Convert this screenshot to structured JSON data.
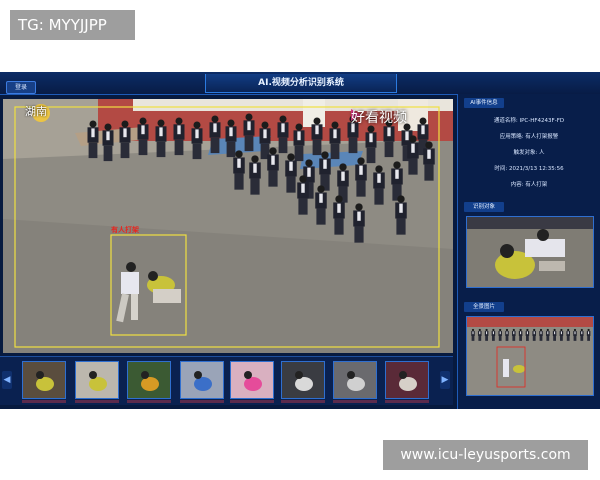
{
  "watermarks": {
    "top": "TG: MYYJJPP",
    "bottom": "www.icu-leyusports.com"
  },
  "app": {
    "title": "AI.视频分析识别系统",
    "login_label": "登录",
    "video": {
      "channel_logo": "湖南",
      "brand": "好看视频",
      "detection_label": "有人打架"
    },
    "thumbnails": [
      {
        "caption": ""
      },
      {
        "caption": ""
      },
      {
        "caption": ""
      },
      {
        "caption": ""
      },
      {
        "caption": ""
      },
      {
        "caption": ""
      },
      {
        "caption": ""
      },
      {
        "caption": ""
      }
    ],
    "panel": {
      "event_section_title": "AI事件信息",
      "channel_line": "通道名称: IPC-HF4243F-FD",
      "app_line": "应用策略: 有人打架报警",
      "trigger_line": "触发对象: 人",
      "time_line": "时间: 2021/3/13 12:35:56",
      "content_line": "内容: 有人打架",
      "target_section_title": "识别对象",
      "scene_section_title": "全景图片"
    },
    "colors": {
      "background": "#071a3f",
      "accent": "#2b7ae0",
      "detection_box": "#f0e040",
      "alarm_box": "#e8261f"
    }
  }
}
